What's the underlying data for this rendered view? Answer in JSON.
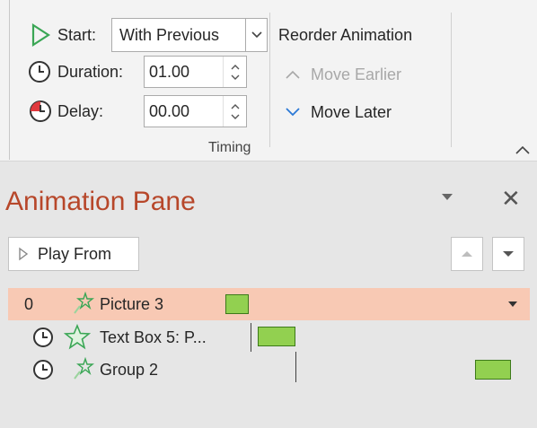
{
  "ribbon": {
    "start_label": "Start:",
    "start_value": "With Previous",
    "duration_label": "Duration:",
    "duration_value": "01.00",
    "delay_label": "Delay:",
    "delay_value": "00.00",
    "timing_group_label": "Timing",
    "reorder_title": "Reorder Animation",
    "move_earlier_label": "Move Earlier",
    "move_later_label": "Move Later"
  },
  "pane": {
    "title": "Animation Pane",
    "play_from_label": "Play From",
    "items": [
      {
        "number": "0",
        "name": "Picture 3"
      },
      {
        "name": "Text Box 5: P..."
      },
      {
        "name": "Group 2"
      }
    ]
  },
  "colors": {
    "accent_title": "#b7472a",
    "selected_row": "#f8c9b4",
    "bar_fill": "#92d050",
    "start_icon_green": "#3aa655",
    "move_later_blue": "#2b79d6"
  }
}
